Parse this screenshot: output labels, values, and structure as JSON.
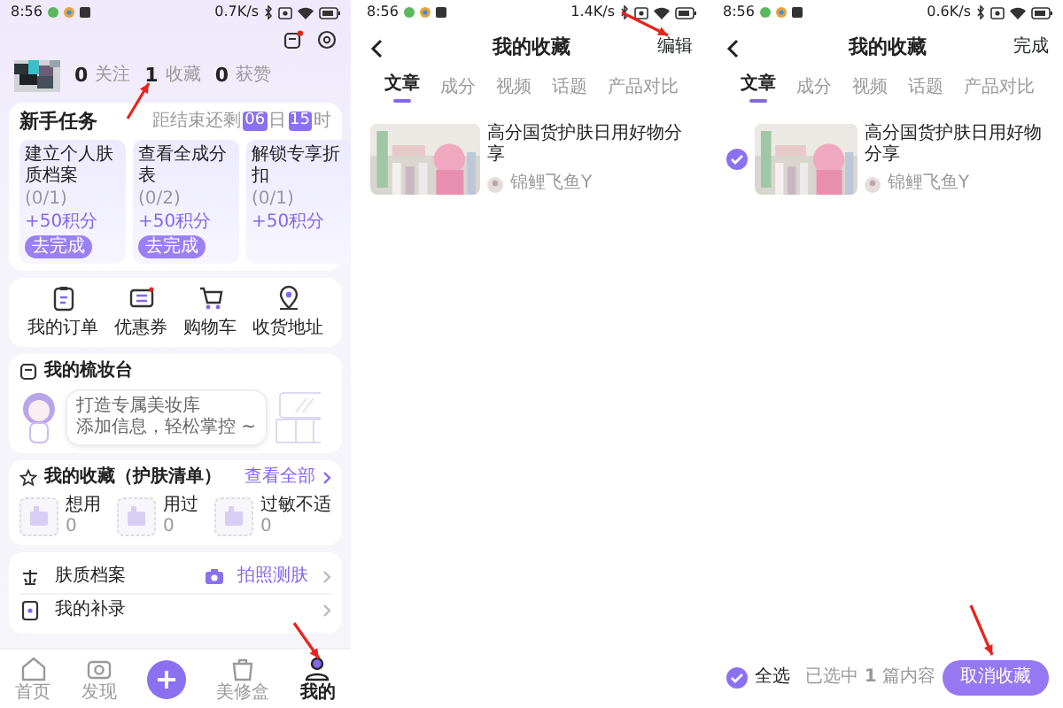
{
  "profile_screen": {
    "status_bar": {
      "time": "8:56",
      "speed": "0.7K/s"
    },
    "stats": [
      {
        "count": "0",
        "label": "关注"
      },
      {
        "count": "1",
        "label": "收藏"
      },
      {
        "count": "0",
        "label": "获赞"
      }
    ],
    "tasks": {
      "title": "新手任务",
      "countdown_prefix": "距结束还剩",
      "days": "06",
      "days_unit": "日",
      "hours": "15",
      "hours_unit": "时",
      "items": [
        {
          "title": "建立个人肤质档案",
          "progress": "(0/1)",
          "reward": "+50积分",
          "action": "去完成"
        },
        {
          "title": "查看全成分表",
          "progress": "(0/2)",
          "reward": "+50积分",
          "action": "去完成"
        },
        {
          "title": "解锁专享折扣",
          "progress": "(0/1)",
          "reward": "+50积分"
        }
      ]
    },
    "shortcuts": [
      {
        "kind": "orders",
        "label": "我的订单"
      },
      {
        "kind": "coupons",
        "label": "优惠券"
      },
      {
        "kind": "cart",
        "label": "购物车"
      },
      {
        "kind": "address",
        "label": "收货地址"
      }
    ],
    "vanity": {
      "title": "我的梳妆台",
      "lines": [
        "打造专属美妆库",
        "添加信息，轻松掌控 ~"
      ]
    },
    "favorites": {
      "title": "我的收藏（护肤清单）",
      "link": "查看全部",
      "items": [
        {
          "label": "想用",
          "count": "0"
        },
        {
          "label": "用过",
          "count": "0"
        },
        {
          "label": "过敏不适",
          "count": "0"
        }
      ]
    },
    "menu": [
      {
        "kind": "skin",
        "label": "肤质档案",
        "action": "拍照测肤"
      },
      {
        "kind": "records",
        "label": "我的补录"
      }
    ],
    "nav": [
      {
        "kind": "home",
        "label": "首页",
        "selected": false
      },
      {
        "kind": "discover",
        "label": "发现",
        "selected": false
      },
      {
        "kind": "add",
        "selected": false
      },
      {
        "kind": "box",
        "label": "美修盒",
        "selected": false
      },
      {
        "kind": "me",
        "label": "我的",
        "selected": true
      }
    ]
  },
  "favorites_screen": {
    "status_bar": {
      "time": "8:56",
      "speed": "1.4K/s"
    },
    "title": "我的收藏",
    "action": "编辑",
    "tabs": [
      {
        "label": "文章",
        "selected": true
      },
      {
        "label": "成分",
        "selected": false
      },
      {
        "label": "视频",
        "selected": false
      },
      {
        "label": "话题",
        "selected": false
      },
      {
        "label": "产品对比",
        "selected": false
      }
    ],
    "articles": [
      {
        "title": "高分国货护肤日用好物分享",
        "author": "锦鲤飞鱼Y"
      }
    ]
  },
  "favorites_edit_screen": {
    "status_bar": {
      "time": "8:56",
      "speed": "0.6K/s"
    },
    "title": "我的收藏",
    "action": "完成",
    "tabs": [
      {
        "label": "文章",
        "selected": true
      },
      {
        "label": "成分",
        "selected": false
      },
      {
        "label": "视频",
        "selected": false
      },
      {
        "label": "话题",
        "selected": false
      },
      {
        "label": "产品对比",
        "selected": false
      }
    ],
    "articles": [
      {
        "title": "高分国货护肤日用好物分享",
        "author": "锦鲤飞鱼Y",
        "selected": true
      }
    ],
    "footer": {
      "select_all_label": "全选",
      "select_all_checked": true,
      "selected_text": "已选中 **1** 篇内容",
      "button": "取消收藏"
    }
  }
}
